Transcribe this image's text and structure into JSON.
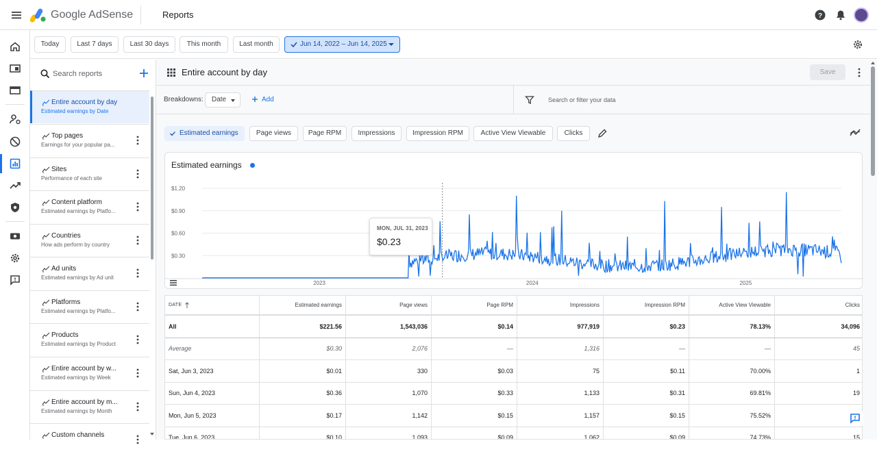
{
  "app": {
    "brand": "Google AdSense",
    "page_title": "Reports"
  },
  "icons": {
    "menu": "hamburger-icon",
    "help": "help-icon",
    "notifications": "bell-icon",
    "avatar": "avatar",
    "settings": "gear-icon"
  },
  "date_presets": {
    "today": "Today",
    "last7": "Last 7 days",
    "last30": "Last 30 days",
    "this_month": "This month",
    "last_month": "Last month",
    "range": "Jun 14, 2022 – Jun 14, 2025"
  },
  "sidebar": {
    "search_placeholder": "Search reports",
    "reports": [
      {
        "name": "Entire account by day",
        "desc": "Estimated earnings by Date"
      },
      {
        "name": "Top pages",
        "desc": "Earnings for your popular pa..."
      },
      {
        "name": "Sites",
        "desc": "Performance of each site"
      },
      {
        "name": "Content platform",
        "desc": "Estimated earnings by Platfo..."
      },
      {
        "name": "Countries",
        "desc": "How ads perform by country"
      },
      {
        "name": "Ad units",
        "desc": "Estimated earnings by Ad unit"
      },
      {
        "name": "Platforms",
        "desc": "Estimated earnings by Platfo..."
      },
      {
        "name": "Products",
        "desc": "Estimated earnings by Product"
      },
      {
        "name": "Entire account by w...",
        "desc": "Estimated earnings by Week"
      },
      {
        "name": "Entire account by m...",
        "desc": "Estimated earnings by Month"
      },
      {
        "name": "Custom channels",
        "desc": ""
      }
    ]
  },
  "report": {
    "title": "Entire account by day",
    "save_label": "Save",
    "breakdowns_label": "Breakdowns:",
    "breakdown_value": "Date",
    "add_label": "Add",
    "filter_placeholder": "Search or filter your data"
  },
  "metrics": {
    "estimated_earnings": "Estimated earnings",
    "page_views": "Page views",
    "page_rpm": "Page RPM",
    "impressions": "Impressions",
    "impression_rpm": "Impression RPM",
    "active_view": "Active View Viewable",
    "clicks": "Clicks"
  },
  "chart_data": {
    "type": "line",
    "title": "Estimated earnings",
    "series_color": "#1a73e8",
    "y_ticks": [
      "$1.20",
      "$0.90",
      "$0.60",
      "$0.30"
    ],
    "x_ticks": [
      "2023",
      "2024",
      "2025"
    ],
    "ylim": [
      0,
      1.2
    ],
    "grid": true,
    "keypoints": [
      {
        "x": "2022-06-14",
        "y": 0.0
      },
      {
        "x": "2023-06-02",
        "y": 0.0
      },
      {
        "x": "2023-06-04",
        "y": 0.36
      },
      {
        "x": "2023-07-31",
        "y": 0.23
      },
      {
        "x": "2023-09-15",
        "y": 0.85
      },
      {
        "x": "2023-12-05",
        "y": 1.1
      },
      {
        "x": "2024-02-20",
        "y": 0.9
      },
      {
        "x": "2024-08-15",
        "y": 1.03
      },
      {
        "x": "2024-11-20",
        "y": 0.95
      },
      {
        "x": "2025-03-12",
        "y": 1.15
      },
      {
        "x": "2025-06-14",
        "y": 0.2
      }
    ],
    "hover": {
      "date": "MON, JUL 31, 2023",
      "value": "$0.23"
    }
  },
  "table": {
    "headers": [
      "DATE",
      "Estimated earnings",
      "Page views",
      "Page RPM",
      "Impressions",
      "Impression RPM",
      "Active View Viewable",
      "Clicks"
    ],
    "rows": [
      [
        "All",
        "$221.56",
        "1,543,036",
        "$0.14",
        "977,919",
        "$0.23",
        "78.13%",
        "34,096"
      ],
      [
        "Average",
        "$0.30",
        "2,076",
        "—",
        "1,316",
        "—",
        "—",
        "45"
      ],
      [
        "Sat, Jun 3, 2023",
        "$0.01",
        "330",
        "$0.03",
        "75",
        "$0.11",
        "70.00%",
        "1"
      ],
      [
        "Sun, Jun 4, 2023",
        "$0.36",
        "1,070",
        "$0.33",
        "1,133",
        "$0.31",
        "69.81%",
        "19"
      ],
      [
        "Mon, Jun 5, 2023",
        "$0.17",
        "1,142",
        "$0.15",
        "1,157",
        "$0.15",
        "75.52%",
        ""
      ],
      [
        "Tue, Jun 6, 2023",
        "$0.10",
        "1,093",
        "$0.09",
        "1,062",
        "$0.09",
        "74.73%",
        "15"
      ]
    ]
  }
}
